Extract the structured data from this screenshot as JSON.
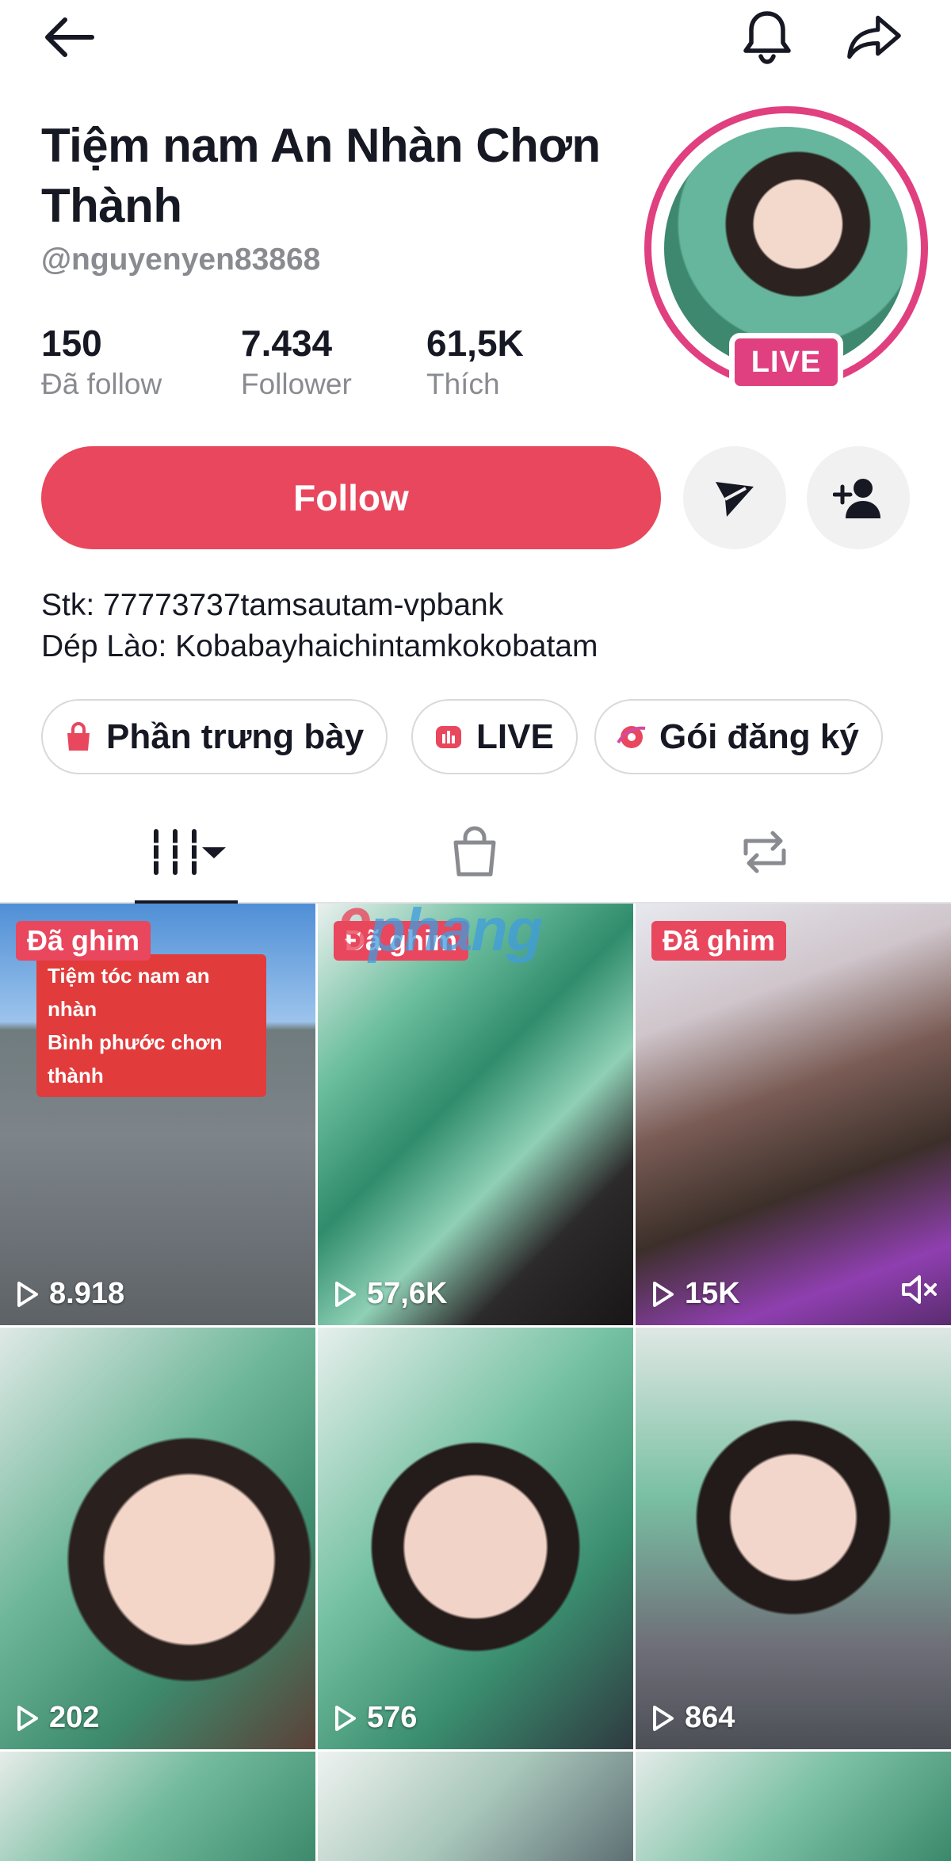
{
  "profile": {
    "display_name": "Tiệm nam An Nhàn Chơn Thành",
    "handle": "@nguyenyen83868",
    "live_badge": "LIVE"
  },
  "stats": [
    {
      "value": "150",
      "label": "Đã follow"
    },
    {
      "value": "7.434",
      "label": "Follower"
    },
    {
      "value": "61,5K",
      "label": "Thích"
    }
  ],
  "actions": {
    "follow_label": "Follow"
  },
  "bio": {
    "line1": "Stk: 77773737tamsautam-vpbank",
    "line2": "Dép Lào: Kobabayhaichintamkokobatam"
  },
  "chips": [
    {
      "label": "Phần trưng bày",
      "icon": "shopping-bag-icon"
    },
    {
      "label": "LIVE",
      "icon": "live-icon"
    },
    {
      "label": "Gói đăng ký",
      "icon": "subscription-icon"
    }
  ],
  "tabs": [
    {
      "icon": "videos-grid-icon",
      "active": true
    },
    {
      "icon": "shop-bag-icon",
      "active": false
    },
    {
      "icon": "repost-icon",
      "active": false
    }
  ],
  "videos": [
    {
      "pinned": "Đã ghim",
      "views": "8.918",
      "caption": [
        "Tiệm tóc nam an nhàn",
        "Bình phước chơn thành"
      ]
    },
    {
      "pinned": "Đã ghim",
      "views": "57,6K"
    },
    {
      "pinned": "Đã ghim",
      "views": "15K",
      "muted": true
    },
    {
      "views": "202"
    },
    {
      "views": "576"
    },
    {
      "views": "864"
    }
  ],
  "watermark": {
    "part1": "9",
    "part2": "phang"
  },
  "colors": {
    "accent": "#e8475d",
    "live_pink": "#e0407f",
    "muted_text": "#8a8b91"
  }
}
